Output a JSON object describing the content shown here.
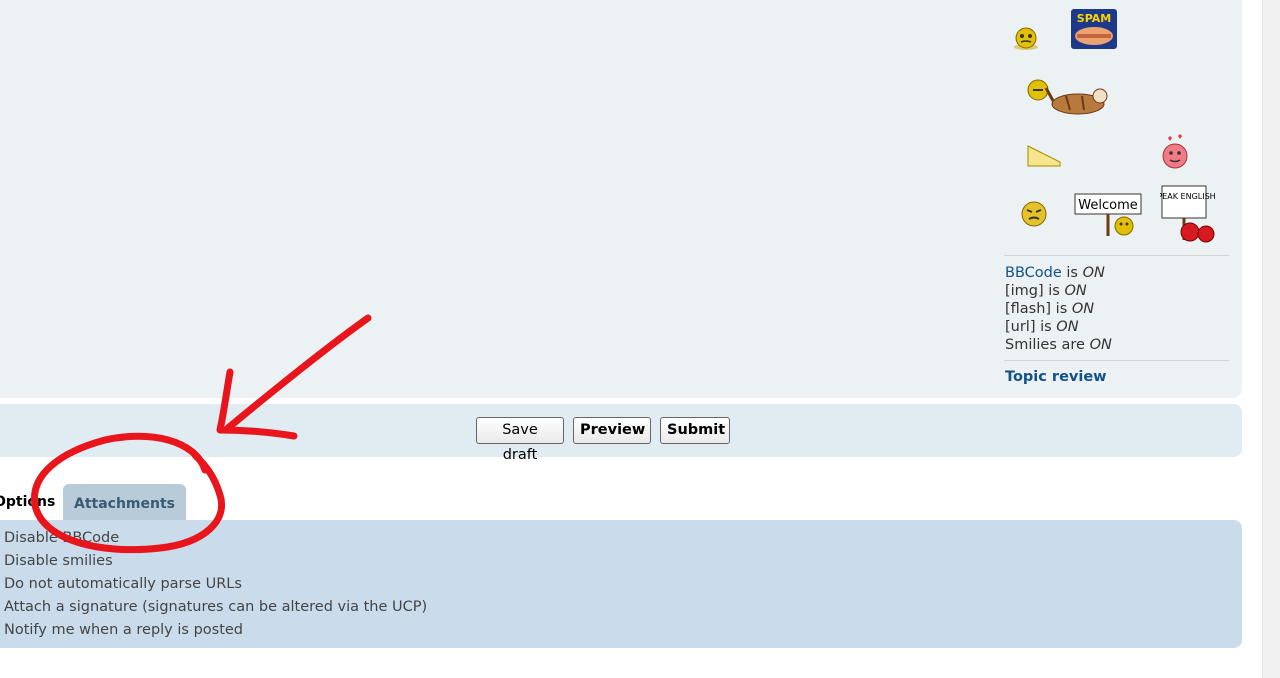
{
  "smilies": [
    {
      "name": "dizzy-smiley-icon"
    },
    {
      "name": "spam-can-smiley-icon",
      "text": "SPAM"
    },
    {
      "name": "sleeping-dog-smiley-icon"
    },
    {
      "name": "cheese-smiley-icon"
    },
    {
      "name": "love-smiley-icon"
    },
    {
      "name": "angry-smiley-icon"
    },
    {
      "name": "welcome-sign-smiley-icon",
      "text": "Welcome"
    },
    {
      "name": "speak-english-sign-smiley-icon",
      "text": "SPEAK ENGLISH"
    }
  ],
  "settings": {
    "bbcode_link": "BBCode",
    "bbcode_rest": " is ",
    "bbcode_state": "ON",
    "img_label": "[img] is ",
    "img_state": "ON",
    "flash_label": "[flash] is ",
    "flash_state": "ON",
    "url_label": "[url] is ",
    "url_state": "ON",
    "smilies_label": "Smilies are ",
    "smilies_state": "ON"
  },
  "topic_review": "Topic review",
  "buttons": {
    "save_draft": "Save draft",
    "preview": "Preview",
    "submit": "Submit"
  },
  "tabs": {
    "options": "Options",
    "attachments": "Attachments"
  },
  "options": [
    "Disable BBCode",
    "Disable smilies",
    "Do not automatically parse URLs",
    "Attach a signature (signatures can be altered via the UCP)",
    "Notify me when a reply is posted"
  ],
  "colors": {
    "link": "#105289",
    "annotation": "#e8161c",
    "options_panel": "#cadceb"
  }
}
